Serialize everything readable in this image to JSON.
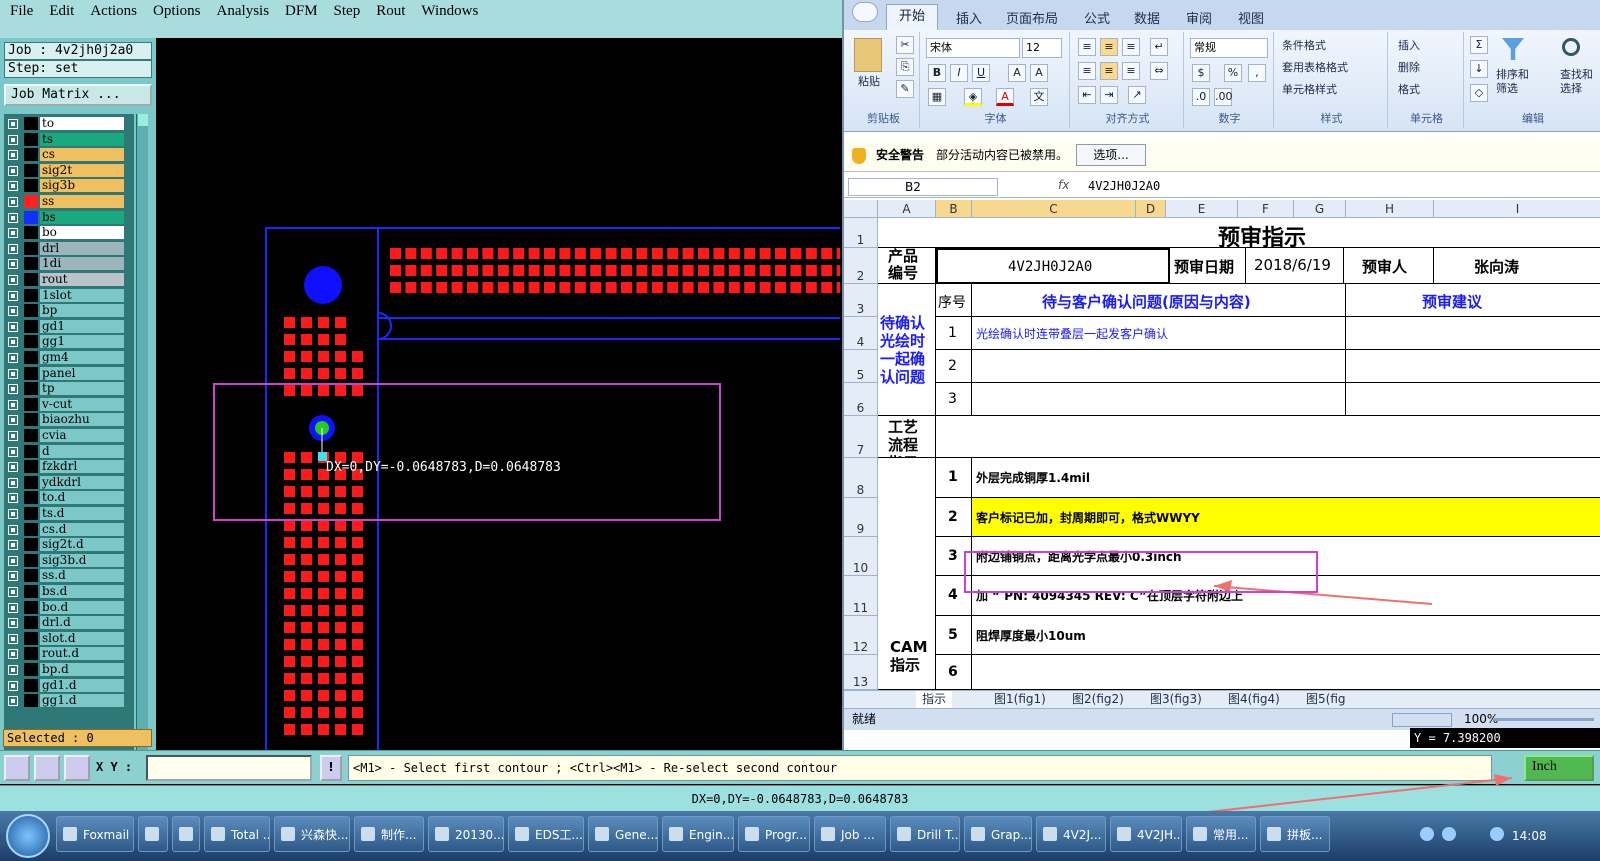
{
  "cam": {
    "menu": [
      "File",
      "Edit",
      "Actions",
      "Options",
      "Analysis",
      "DFM",
      "Step",
      "Rout",
      "Windows"
    ],
    "job_label": "Job : 4v2jh0j2a0",
    "step_label": "Step: set",
    "job_matrix_button": "Job Matrix ...",
    "layers": [
      {
        "name": "to",
        "color": "#ffffff"
      },
      {
        "name": "ts",
        "color": "#1aa880"
      },
      {
        "name": "cs",
        "color": "#f0c060"
      },
      {
        "name": "sig2t",
        "color": "#f0c060"
      },
      {
        "name": "sig3b",
        "color": "#f0c060"
      },
      {
        "name": "ss",
        "color": "#f0c060",
        "swatch": "#ff2020",
        "active": true
      },
      {
        "name": "bs",
        "color": "#1aa880",
        "swatch": "#1030ff",
        "active": true
      },
      {
        "name": "bo",
        "color": "#ffffff"
      },
      {
        "name": "drl",
        "color": "#9cb4bc"
      },
      {
        "name": "1di",
        "color": "#9cb4bc"
      },
      {
        "name": "rout",
        "color": "#b8c4c8"
      },
      {
        "name": "1slot",
        "color": "#7cc8c8"
      },
      {
        "name": "bp",
        "color": "#7cc8c8"
      },
      {
        "name": "gd1",
        "color": "#7cc8c8"
      },
      {
        "name": "gg1",
        "color": "#7cc8c8"
      },
      {
        "name": "gm4",
        "color": "#7cc8c8"
      },
      {
        "name": "panel",
        "color": "#7cc8c8"
      },
      {
        "name": "tp",
        "color": "#7cc8c8"
      },
      {
        "name": "v-cut",
        "color": "#7cc8c8"
      },
      {
        "name": "biaozhu",
        "color": "#7cc8c8"
      },
      {
        "name": "cvia",
        "color": "#7cc8c8"
      },
      {
        "name": "d",
        "color": "#7cc8c8"
      },
      {
        "name": "fzkdrl",
        "color": "#7cc8c8"
      },
      {
        "name": "ydkdrl",
        "color": "#7cc8c8"
      },
      {
        "name": "to.d",
        "color": "#7cc8c8"
      },
      {
        "name": "ts.d",
        "color": "#7cc8c8"
      },
      {
        "name": "cs.d",
        "color": "#7cc8c8"
      },
      {
        "name": "sig2t.d",
        "color": "#7cc8c8"
      },
      {
        "name": "sig3b.d",
        "color": "#7cc8c8"
      },
      {
        "name": "ss.d",
        "color": "#7cc8c8"
      },
      {
        "name": "bs.d",
        "color": "#7cc8c8"
      },
      {
        "name": "bo.d",
        "color": "#7cc8c8"
      },
      {
        "name": "drl.d",
        "color": "#7cc8c8"
      },
      {
        "name": "slot.d",
        "color": "#7cc8c8"
      },
      {
        "name": "rout.d",
        "color": "#7cc8c8"
      },
      {
        "name": "bp.d",
        "color": "#7cc8c8"
      },
      {
        "name": "gd1.d",
        "color": "#7cc8c8"
      },
      {
        "name": "gg1.d",
        "color": "#7cc8c8"
      }
    ],
    "selected_text": "Selected : 0",
    "measure_text": "DX=0,DY=-0.0648783,D=0.0648783",
    "xy_label": "X Y :",
    "bang_label": "!",
    "cmd_prompt": "<M1> - Select first contour ; <Ctrl><M1> - Re-select second contour",
    "units_button": "Inch",
    "status_text": "DX=0,DY=-0.0648783,D=0.0648783",
    "coord_readout": "Y = 7.398200"
  },
  "excel": {
    "tabs": [
      "开始",
      "插入",
      "页面布局",
      "公式",
      "数据",
      "审阅",
      "视图"
    ],
    "ribbon": {
      "paste": "粘贴",
      "clipboard": "剪贴板",
      "font_name": "宋体",
      "font_size": "12",
      "font_group": "字体",
      "align_group": "对齐方式",
      "number_format": "常规",
      "number_group": "数字",
      "cond_format": "条件格式",
      "table_format": "套用表格格式",
      "cell_style": "单元格样式",
      "style_group": "样式",
      "insert": "插入",
      "delete": "删除",
      "format": "格式",
      "cells_group": "单元格",
      "sort_filter": "排序和筛选",
      "find_select": "查找和选择",
      "edit_group": "编辑"
    },
    "security_title": "安全警告",
    "security_msg": "部分活动内容已被禁用。",
    "options_btn": "选项...",
    "namebox": "B2",
    "fx": "fx",
    "formula_value": "4V2JH0J2A0",
    "columns": [
      "A",
      "B",
      "C",
      "D",
      "E",
      "F",
      "G",
      "H",
      "I"
    ],
    "rows": [
      "1",
      "2",
      "3",
      "4",
      "5",
      "6",
      "7",
      "8",
      "9",
      "10",
      "11",
      "12",
      "13"
    ],
    "sheet": {
      "title": "预审指示",
      "product_label": "产品编号",
      "product_value": "4V2JH0J2A0",
      "date_label": "预审日期",
      "date_value": "2018/6/19",
      "reviewer_label": "预审人",
      "reviewer_value": "张向涛",
      "seq_label": "序号",
      "issues_header": "待与客户确认问题(原因与内容)",
      "advice_header": "预审建议",
      "section_confirm": "待确认光绘时一起确认问题",
      "issue_rows": [
        {
          "n": "1",
          "text": "光绘确认时连带叠层一起发客户确认"
        },
        {
          "n": "2",
          "text": ""
        },
        {
          "n": "3",
          "text": ""
        }
      ],
      "process_label": "工艺流程指示",
      "cam_label": "CAM指示",
      "cam_rows": [
        {
          "n": "1",
          "text": "外层完成铜厚1.4mil"
        },
        {
          "n": "2",
          "text": "客户标记已加，封周期即可，格式WWYY"
        },
        {
          "n": "3",
          "text": "附边铺铜点，距离光学点最小0.3inch"
        },
        {
          "n": "4",
          "text": "加 “ PN: 4094345 REV: C”在顶层字符附边上"
        },
        {
          "n": "5",
          "text": "阻焊厚度最小10um"
        },
        {
          "n": "6",
          "text": ""
        }
      ]
    },
    "sheet_tabs": [
      "指示",
      "图1(fig1)",
      "图2(fig2)",
      "图3(fig3)",
      "图4(fig4)",
      "图5(fig"
    ],
    "status": "就绪",
    "zoom": "100%"
  },
  "taskbar": {
    "items": [
      "Foxmail",
      "",
      "",
      "Total ...",
      "兴森快...",
      "制作...",
      "20130...",
      "EDS工...",
      "Gene...",
      "Engin...",
      "Progr...",
      "Job ...",
      "Drill T...",
      "Grap...",
      "4V2J...",
      "4V2JH...",
      "常用...",
      "拼板..."
    ],
    "clock": "14:08"
  }
}
